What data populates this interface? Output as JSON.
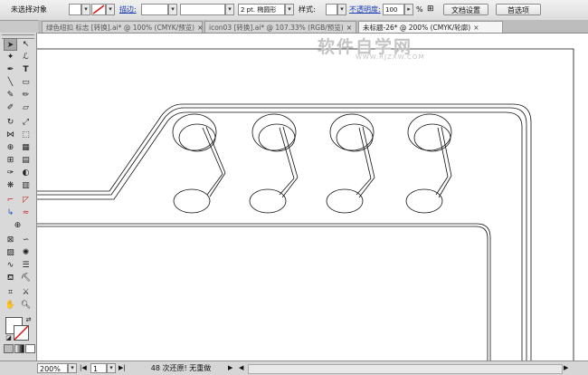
{
  "control_bar": {
    "selection_status": "未选择对象",
    "stroke_label": "描边:",
    "stroke_weight_options": "",
    "brush_value": "",
    "brush_label": "2 pt. 椭圆形",
    "style_label": "样式:",
    "opacity_label": "不透明度:",
    "opacity_value": "100",
    "percent": "%",
    "doc_setup_button": "文档设置",
    "preferences_button": "首选项"
  },
  "tabs": [
    {
      "label": "绿色纽扣 标志 [转换].ai* @ 100% (CMYK/预览)",
      "active": false
    },
    {
      "label": "icon03 [转换].ai* @ 107.33% (RGB/预览)",
      "active": false
    },
    {
      "label": "未标题-26* @ 200% (CMYK/轮廓)",
      "active": true
    }
  ],
  "watermark": {
    "main": "软件自学网",
    "sub": "WWW.RJZXW.COM"
  },
  "status_bar": {
    "zoom": "200%",
    "page": "1",
    "info": "48 次还原! 无重做",
    "left_arrow": "◀",
    "right_arrow": "▶"
  },
  "tool_icons": [
    "selection-tool-icon",
    "direct-selection-tool-icon",
    "magic-wand-icon",
    "lasso-icon",
    "pen-icon",
    "type-icon",
    "line-icon",
    "rectangle-icon",
    "paintbrush-icon",
    "pencil-icon",
    "blob-brush-icon",
    "eraser-icon",
    "rotate-icon",
    "scale-icon",
    "width-icon",
    "free-transform-icon",
    "shape-builder-icon",
    "perspective-icon",
    "mesh-icon",
    "gradient-icon",
    "eyedropper-icon",
    "blend-icon",
    "symbol-sprayer-icon",
    "column-graph-icon",
    "artboard-icon",
    "slice-icon",
    "hand-icon",
    "zoom-icon"
  ]
}
